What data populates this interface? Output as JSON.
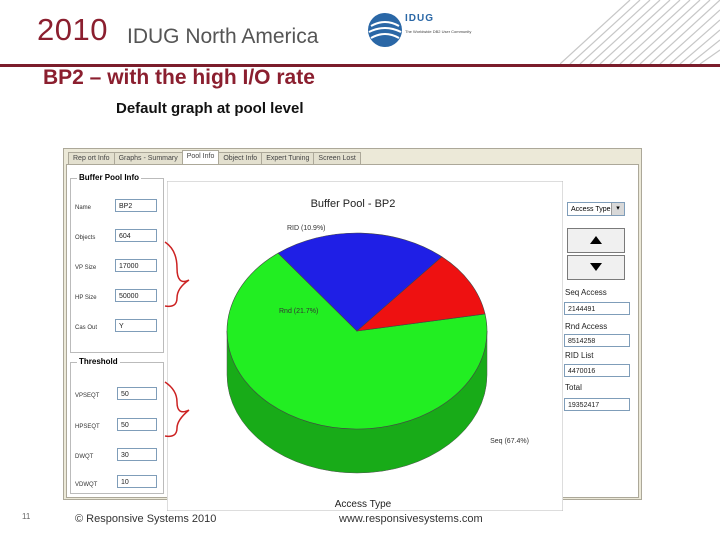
{
  "header": {
    "year": "2010",
    "event": "IDUG North America",
    "logo_text": "IDUG",
    "logo_tagline": "The Worldwide DB2 User Community"
  },
  "slide": {
    "title": "BP2 – with the high I/O rate",
    "subtitle": "Default graph at pool level"
  },
  "app": {
    "tabs": [
      {
        "label": "Rep ort Info"
      },
      {
        "label": "Graphs - Summary"
      },
      {
        "label": "Pool Info"
      },
      {
        "label": "Object Info"
      },
      {
        "label": "Expert Tuning"
      },
      {
        "label": "Screen Lost"
      }
    ],
    "active_tab": 2,
    "buffer_pool_info": {
      "title": "Buffer Pool Info",
      "fields": [
        {
          "label": "Name",
          "value": "BP2"
        },
        {
          "label": "Objects",
          "value": "604"
        },
        {
          "label": "VP Size",
          "value": "17000"
        },
        {
          "label": "HP Size",
          "value": "50000"
        },
        {
          "label": "Cas Out",
          "value": "Y"
        }
      ]
    },
    "threshold": {
      "title": "Threshold",
      "fields": [
        {
          "label": "VPSEQT",
          "value": "50"
        },
        {
          "label": "HPSEQT",
          "value": "50"
        },
        {
          "label": "DWQT",
          "value": "30"
        },
        {
          "label": "VDWQT",
          "value": "10"
        }
      ]
    },
    "right_panel": {
      "dropdown_value": "Access Type",
      "up_button": "up-arrow-icon",
      "down_button": "down-arrow-icon",
      "fields": [
        {
          "label": "Seq Access",
          "value": "2144491"
        },
        {
          "label": "Rnd Access",
          "value": "8514258"
        },
        {
          "label": "RID List",
          "value": "4470016"
        },
        {
          "label": "Total",
          "value": "19352417"
        }
      ]
    }
  },
  "chart_data": {
    "type": "pie",
    "title": "Buffer Pool - BP2",
    "xlabel": "Access Type",
    "slices": [
      {
        "label": "Seq (67.4%)",
        "value": 67.4,
        "color": "#22ee22"
      },
      {
        "label": "Rnd (21.7%)",
        "value": 21.7,
        "color": "#1f1fe6"
      },
      {
        "label": "RID (10.9%)",
        "value": 10.9,
        "color": "#ee1111"
      }
    ]
  },
  "footer": {
    "slide_number": "11",
    "copyright": "© Responsive Systems 2010",
    "url": "www.responsivesystems.com"
  }
}
